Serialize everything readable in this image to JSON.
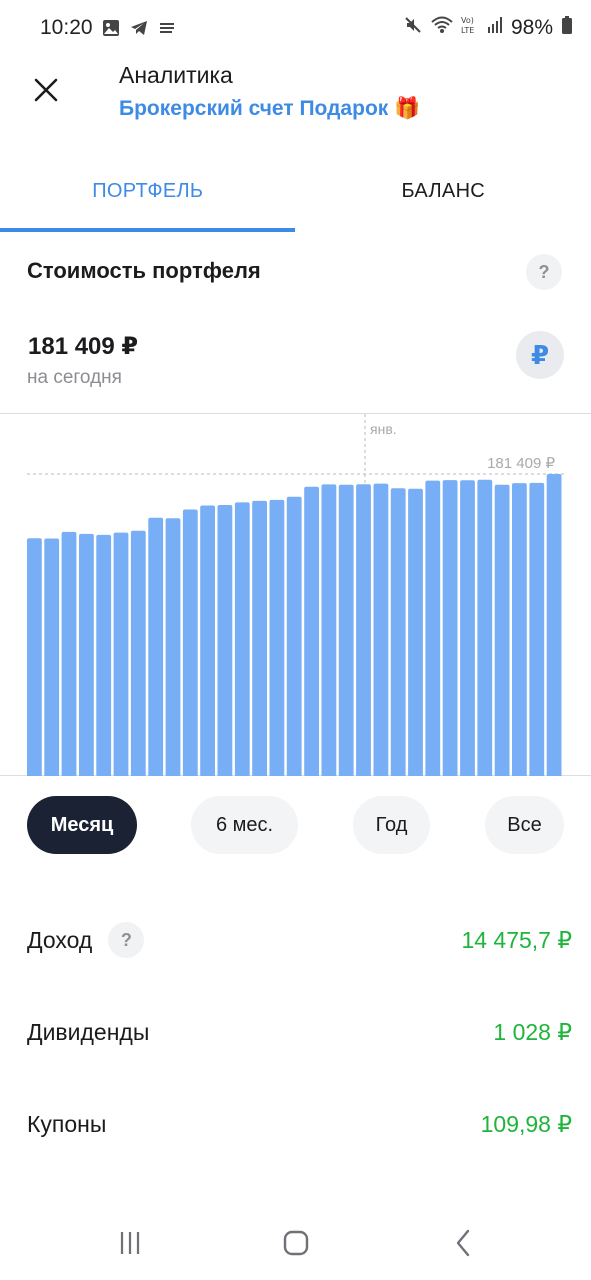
{
  "status_bar": {
    "time": "10:20",
    "battery": "98%",
    "icons": [
      "image-icon",
      "telegram-icon",
      "notes-icon",
      "mute-icon",
      "wifi-icon",
      "volte-icon",
      "signal-icon",
      "battery-icon"
    ]
  },
  "header": {
    "title": "Аналитика",
    "subtitle": "Брокерский счет Подарок",
    "subtitle_emoji": "🎁"
  },
  "tabs": [
    {
      "label": "ПОРТФЕЛЬ",
      "active": true
    },
    {
      "label": "БАЛАНС",
      "active": false
    }
  ],
  "portfolio": {
    "title": "Стоимость портфеля",
    "help": "?",
    "value": "181 409 ₽",
    "caption": "на сегодня",
    "currency_symbol": "₽"
  },
  "chart_data": {
    "type": "bar",
    "month_label": "янв.",
    "max_label": "181 409 ₽",
    "values": [
      161850,
      161800,
      163100,
      162700,
      162500,
      162950,
      163300,
      165900,
      165800,
      167500,
      168300,
      168400,
      168900,
      169200,
      169400,
      170000,
      172000,
      172450,
      172400,
      172500,
      172600,
      171700,
      171600,
      173200,
      173300,
      173250,
      173350,
      172400,
      172700,
      172750,
      174500
    ],
    "bar_color": "#78aef5",
    "guide_color": "#b9bbc0"
  },
  "periods": [
    {
      "label": "Месяц",
      "selected": true
    },
    {
      "label": "6 мес.",
      "selected": false
    },
    {
      "label": "Год",
      "selected": false
    },
    {
      "label": "Все",
      "selected": false
    }
  ],
  "stats": [
    {
      "label": "Доход",
      "value": "14 475,7 ₽",
      "help": "?"
    },
    {
      "label": "Дивиденды",
      "value": "1 028 ₽"
    },
    {
      "label": "Купоны",
      "value": "109,98 ₽"
    }
  ],
  "colors": {
    "accent": "#3d8be4",
    "positive": "#1fb43b",
    "selected_period_bg": "#1b2233"
  }
}
